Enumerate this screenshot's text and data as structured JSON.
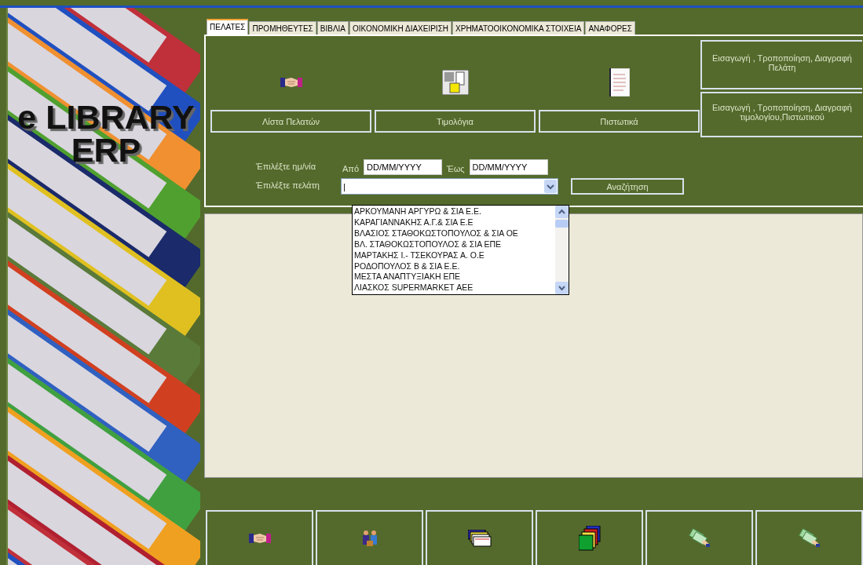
{
  "logo": {
    "lines": [
      "e LIBRARY",
      "ERP"
    ]
  },
  "tabs": [
    {
      "label": "ΠΕΛΑΤΕΣ",
      "selected": true
    },
    {
      "label": "ΠΡΟΜΗΘΕΥΤΕΣ",
      "selected": false
    },
    {
      "label": "ΒΙΒΛΙΑ",
      "selected": false
    },
    {
      "label": "ΟΙΚΟΝΟΜΙΚΗ ΔΙΑΧΕΙΡΙΣΗ",
      "selected": false
    },
    {
      "label": "ΧΡΗΜΑΤΟΟΙΚΟΝΟΜΙΚΑ ΣΤΟΙΧΕΙΑ",
      "selected": false
    },
    {
      "label": "ΑΝΑΦΟΡΕΣ",
      "selected": false
    }
  ],
  "feature_buttons": [
    {
      "label": "Λίστα Πελατών",
      "kind": "handshake"
    },
    {
      "label": "Τιμολόγια",
      "kind": "calendar"
    },
    {
      "label": "Πιστωτικά",
      "kind": "document"
    }
  ],
  "side_buttons": [
    "Εισαγωγή , Τροποποίηση, Διαγραφή Πελάτη",
    "Εισαγωγή , Τροποποίηση, Διαγραφή τιμολογίου,Πιστωτικού"
  ],
  "filters": {
    "date_label": "Έπιλέξτε ημ/νία",
    "from_label": "Από",
    "from_value": "DD/MM/YYYY",
    "to_label": "Έως",
    "to_value": "DD/MM/YYYY",
    "customer_label": "Έπιλέξτε πελάτη",
    "customer_value": "|",
    "search_button": "Αναζήτηση"
  },
  "customer_dropdown": {
    "expanded": true,
    "options": [
      {
        "label": "ΑΡΚΟΥΜΑΝΗ ΑΡΓΥΡΩ & ΣΙΑ Ε.Ε.",
        "selected": false
      },
      {
        "label": "ΚΑΡΑΓΙΑΝΝΑΚΗΣ Α.Γ.& ΣΙΑ Ε.Ε",
        "selected": false
      },
      {
        "label": "ΒΛΑΣΙΟΣ ΣΤΑΘΟΚΩΣΤΟΠΟΥΛΟΣ & ΣΙΑ ΟΕ",
        "selected": false
      },
      {
        "label": "ΒΛ. ΣΤΑΘΟΚΩΣΤΟΠΟΥΛΟΣ & ΣΙΑ ΕΠΕ",
        "selected": false
      },
      {
        "label": "ΜΑΡΤΑΚΗΣ Ι.- ΤΣΕΚΟΥΡΑΣ Α.  Ο.Ε",
        "selected": false
      },
      {
        "label": "ΡΟΔΟΠΟΥΛΟΣ Β & ΣΙΑ Ε.Ε.",
        "selected": false
      },
      {
        "label": "ΜΕΣΤΑ ΑΝΑΠΤΥΞΙΑΚΗ ΕΠΕ",
        "selected": false
      },
      {
        "label": "ΛΙΑΣΚΟΣ SUPERMARKET ΑΕΕ",
        "selected": false
      }
    ]
  },
  "bottom_buttons": [
    {
      "kind": "handshake"
    },
    {
      "kind": "people"
    },
    {
      "kind": "cards"
    },
    {
      "kind": "folders"
    },
    {
      "kind": "money"
    },
    {
      "kind": "money"
    }
  ]
}
